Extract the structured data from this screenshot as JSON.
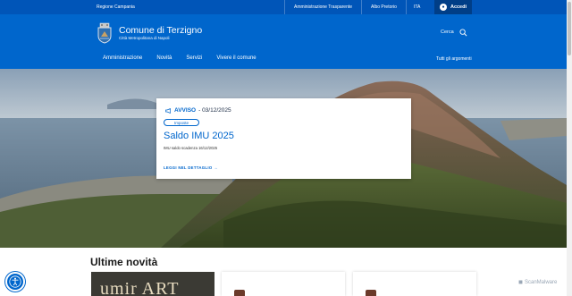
{
  "topbar": {
    "region": "Regione Campania",
    "links": [
      "Amministrazione Trasparente",
      "Albo Pretorio",
      "ITA"
    ],
    "login": "Accedi"
  },
  "header": {
    "title": "Comune di Terzigno",
    "subtitle": "Città Metropolitana di Napoli",
    "search_label": "Cerca",
    "nav": [
      "Amministrazione",
      "Novità",
      "Servizi",
      "Vivere il comune"
    ],
    "nav_right": "Tutti gli argomenti"
  },
  "hero_card": {
    "kicker": "AVVISO",
    "date": "- 03/12/2025",
    "tag": "Imposte",
    "title": "Saldo IMU 2025",
    "description": "IMU saldo scadenza 16/12/2025",
    "cta": "LEGGI NEL DETTAGLIO"
  },
  "news": {
    "heading": "Ultime novità",
    "card1_text": "umir ART"
  },
  "watermark": "ScanMalware",
  "colors": {
    "primary": "#0066cc",
    "dark": "#0055b8"
  },
  "icons": [
    "megaphone-icon",
    "search-icon",
    "arrow-right-icon",
    "accessibility-icon",
    "user-icon"
  ]
}
